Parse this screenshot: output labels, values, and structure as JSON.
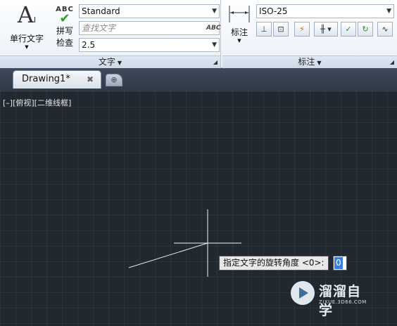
{
  "ribbon": {
    "text_panel": {
      "single_line_text_label": "单行文字",
      "spell_check_abc": "ABC",
      "spell_check_line1": "拼写",
      "spell_check_line2": "检查",
      "style_value": "Standard",
      "find_placeholder": "查找文字",
      "find_button_label": "ABC",
      "height_value": "2.5",
      "footer_label": "文字"
    },
    "dim_panel": {
      "dimension_label": "标注",
      "dim_style_value": "ISO-25",
      "footer_label": "标注"
    }
  },
  "tabs": {
    "active_label": "Drawing1*",
    "close_glyph": "✖"
  },
  "canvas": {
    "viewport_label": "[–][俯视][二维线框]",
    "prompt_text": "指定文字的旋转角度 <0>:",
    "input_value": "0",
    "background_color": "#212830"
  },
  "watermark": {
    "title": "溜溜自学",
    "url": "ZIXUE.3D66.COM"
  }
}
